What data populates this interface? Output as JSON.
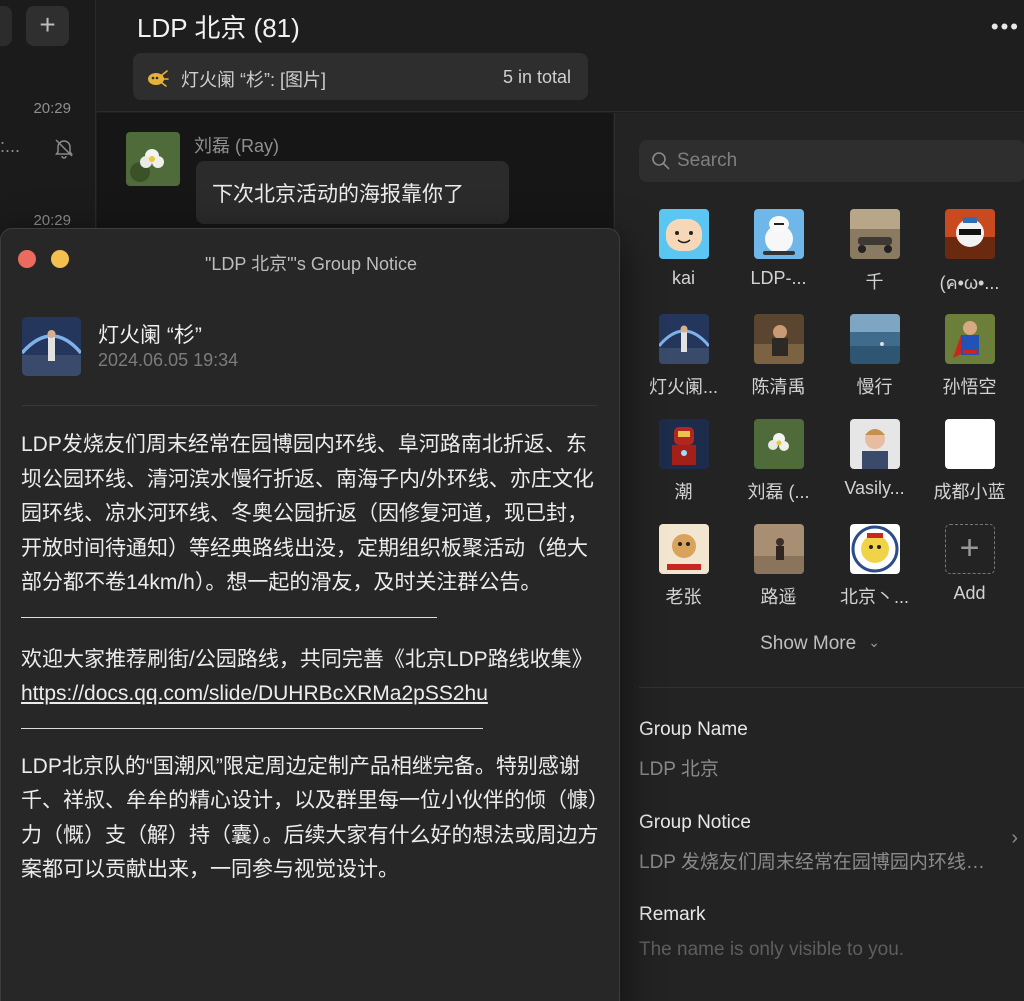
{
  "sidebar": {
    "add_label": "+",
    "conversations": [
      {
        "time": "20:29",
        "preview": ":..."
      },
      {
        "time": "20:29"
      }
    ]
  },
  "chat": {
    "title": "LDP 北京  (81)",
    "more_label": "•••",
    "notice_bar": {
      "preview": "灯火阑 “杉”: [图片]",
      "total": "5 in total"
    },
    "messages": [
      {
        "sender": "刘磊 (Ray)",
        "text": "下次北京活动的海报靠你了"
      }
    ]
  },
  "notice_window": {
    "title": "\"LDP 北京\"'s Group Notice",
    "author": "灯火阑 “杉”",
    "date": "2024.06.05  19:34",
    "paragraph1": "LDP发烧友们周末经常在园博园内环线、阜河路南北折返、东坝公园环线、清河滨水慢行折返、南海子内/外环线、亦庄文化园环线、凉水河环线、冬奥公园折返（因修复河道，现已封，开放时间待通知）等经典路线出没，定期组织板聚活动（绝大部分都不卷14km/h）。想一起的滑友，及时关注群公告。",
    "paragraph2": "欢迎大家推荐刷街/公园路线，共同完善《北京LDP路线收集》",
    "link": "https://docs.qq.com/slide/DUHRBcXRMa2pSS2hu",
    "paragraph3": "LDP北京队的“国潮风”限定周边定制产品相继完备。特别感谢千、祥叔、牟牟的精心设计，以及群里每一位小伙伴的倾（慷）力（慨）支（解）持（囊）。后续大家有什么好的想法或周边方案都可以贡献出来，一同参与视觉设计。"
  },
  "panel": {
    "search_placeholder": "Search",
    "members": [
      {
        "name": "kai"
      },
      {
        "name": "LDP-..."
      },
      {
        "name": "千"
      },
      {
        "name": "(ค•ω•..."
      },
      {
        "name": "灯火阑..."
      },
      {
        "name": "陈清禹"
      },
      {
        "name": "慢行"
      },
      {
        "name": "孙悟空"
      },
      {
        "name": "潮"
      },
      {
        "name": "刘磊 (..."
      },
      {
        "name": "Vasily..."
      },
      {
        "name": "成都小蓝"
      },
      {
        "name": "老张"
      },
      {
        "name": "路遥"
      },
      {
        "name": "北京丶..."
      }
    ],
    "add_label": "Add",
    "show_more": "Show More",
    "group_name_label": "Group Name",
    "group_name": "LDP 北京",
    "group_notice_label": "Group Notice",
    "group_notice": "LDP 发烧友们周末经常在园博园内环线、阜河路南北折返...",
    "remark_label": "Remark",
    "remark_hint": "The name is only visible to you."
  }
}
